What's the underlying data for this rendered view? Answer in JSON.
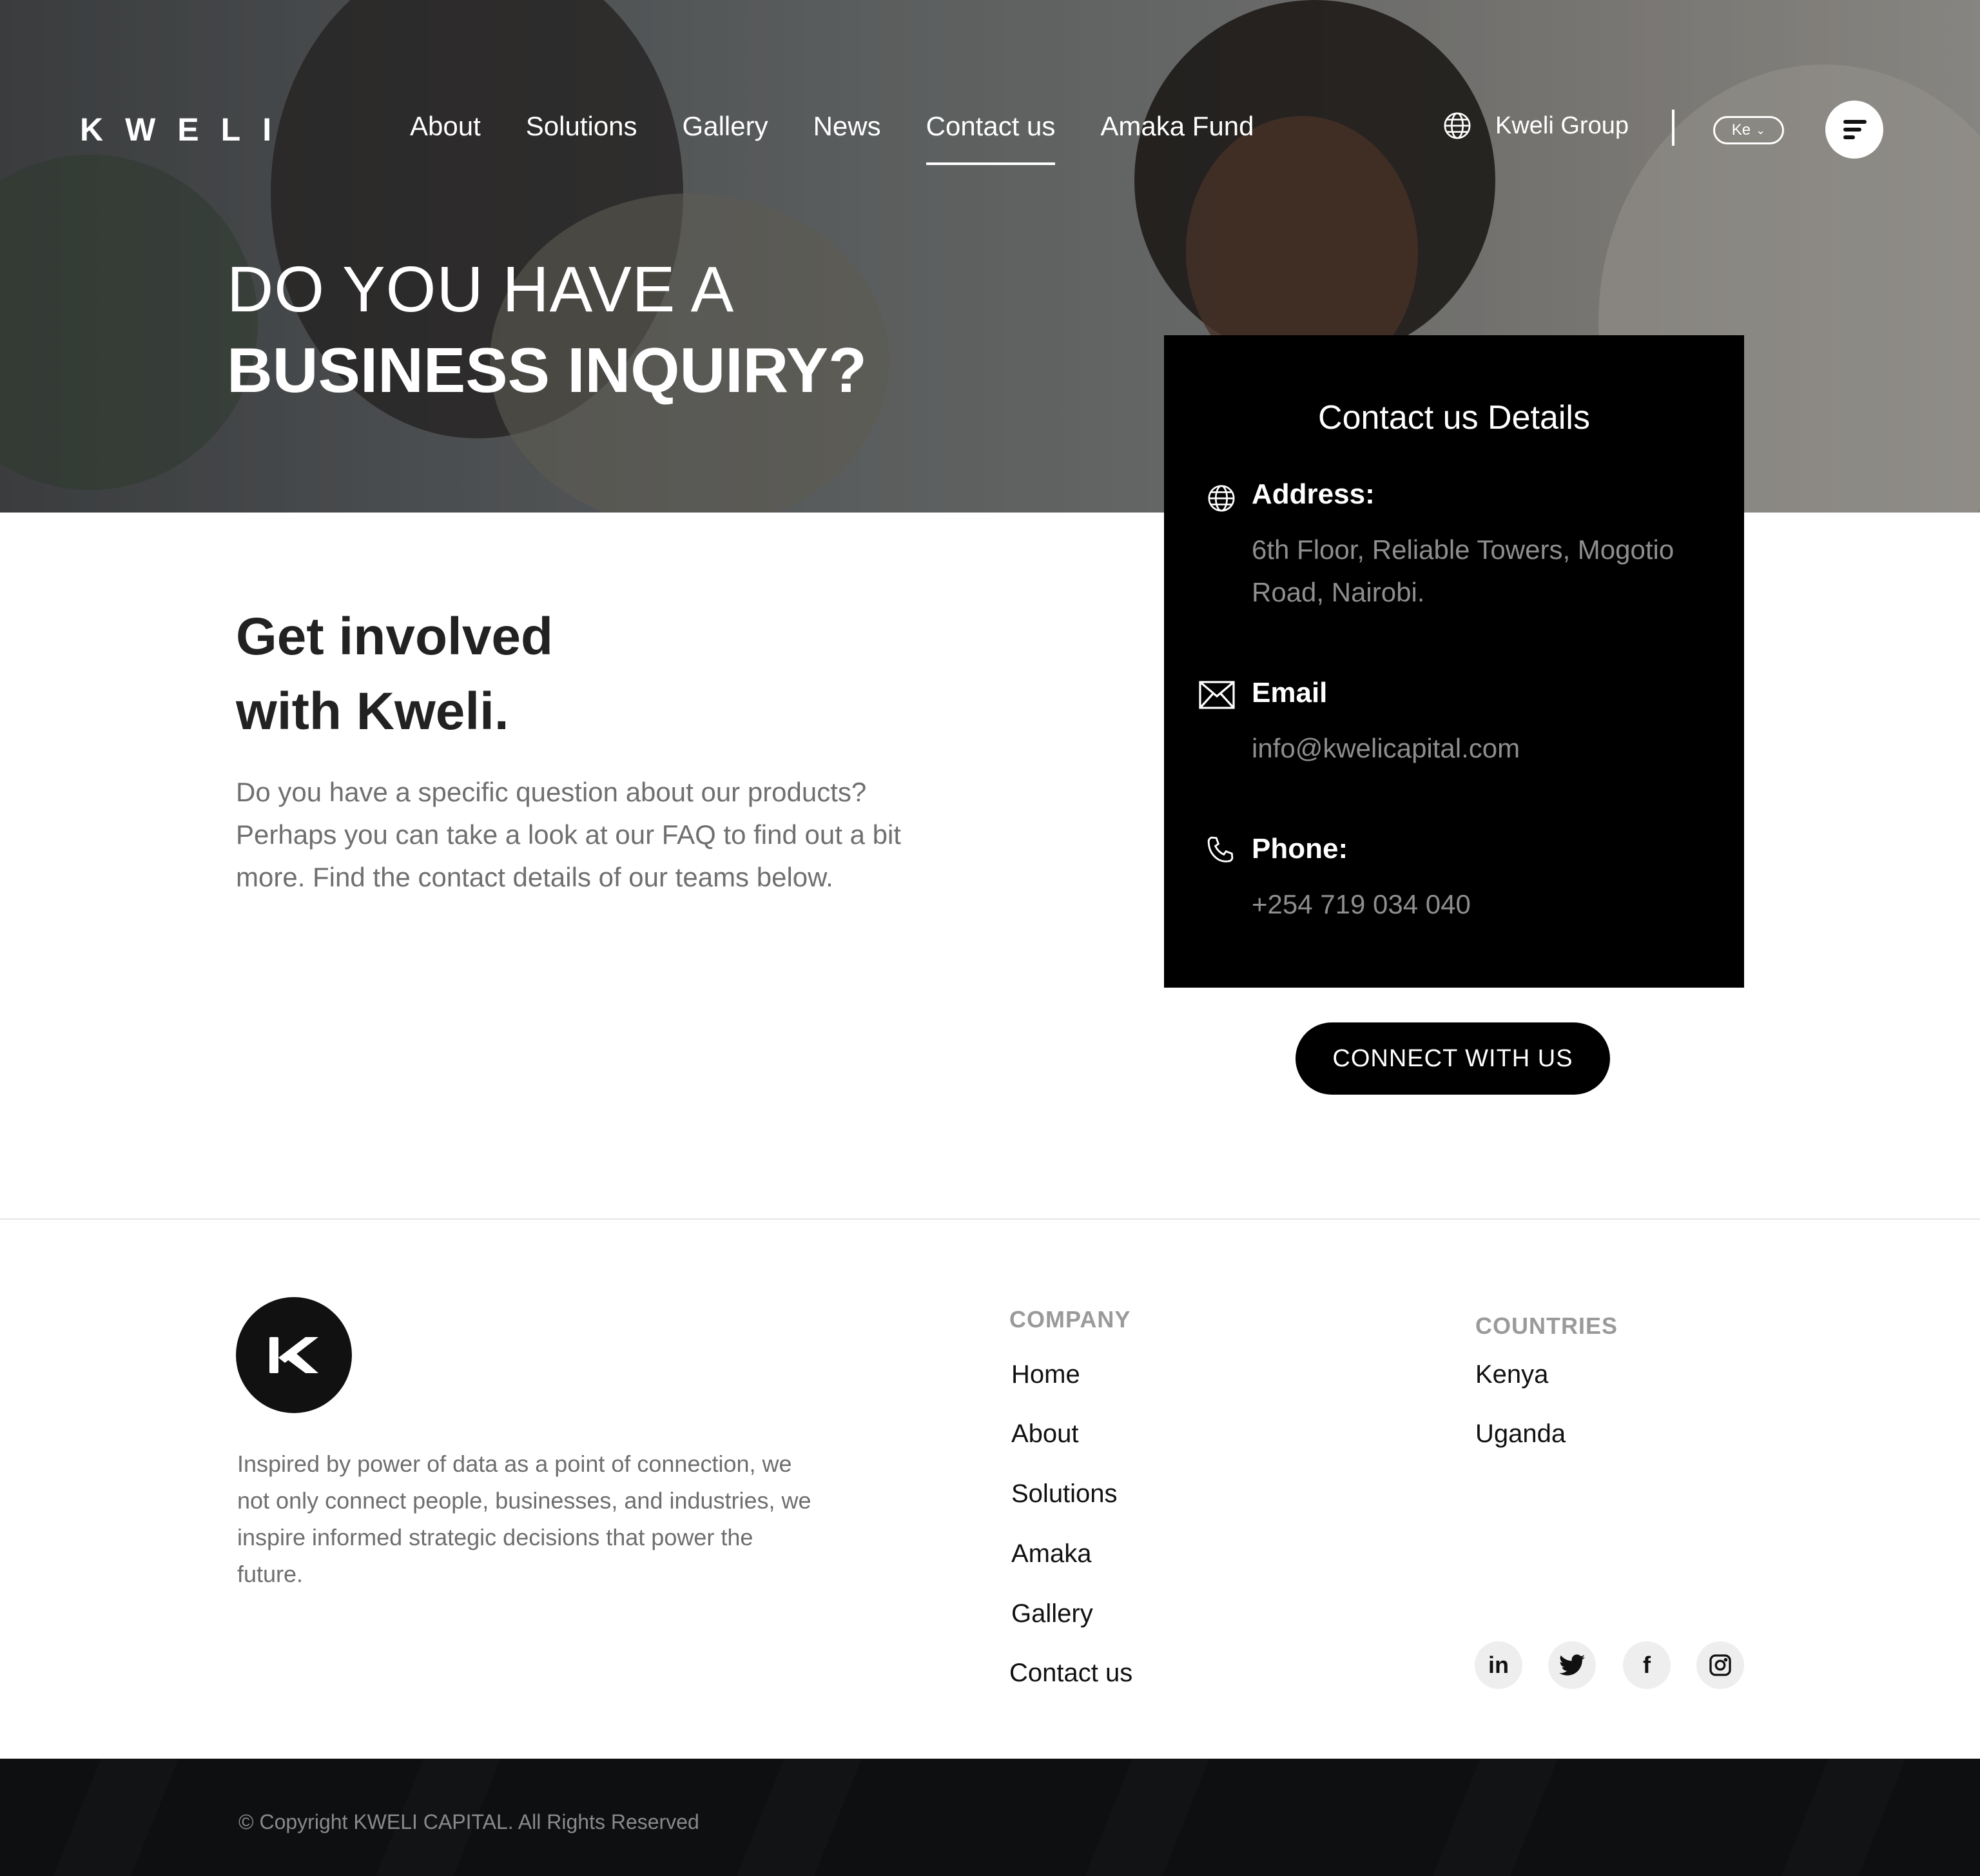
{
  "header": {
    "logo_text": "KWELI",
    "nav": [
      "About",
      "Solutions",
      "Gallery",
      "News",
      "Contact us",
      "Amaka Fund"
    ],
    "active_nav": "Contact us",
    "group_link": "Kweli Group",
    "language": "Ke",
    "menu_icon": "menu-icon"
  },
  "hero": {
    "line1": "DO YOU HAVE A",
    "line2": "BUSINESS INQUIRY?"
  },
  "contact_card": {
    "title": "Contact us Details",
    "address_label": "Address:",
    "address_value": "6th Floor, Reliable Towers, Mogotio Road, Nairobi.",
    "email_label": "Email",
    "email_value": "info@kwelicapital.com",
    "phone_label": "Phone:",
    "phone_value": "+254 719 034 040"
  },
  "cta": {
    "label": "CONNECT WITH US"
  },
  "intro": {
    "title_line1": "Get involved",
    "title_line2": "with Kweli.",
    "text": "Do you have a specific question about our products? Perhaps you can take a look at our FAQ to find out a bit more. Find the contact details of our teams below."
  },
  "footer": {
    "logo_letter": "K",
    "description": "Inspired by power of data as a point of connection, we not only connect people, businesses, and industries, we inspire informed strategic decisions that power the future.",
    "company_heading": "COMPANY",
    "company_links": [
      "Home",
      "About",
      "Solutions",
      "Amaka",
      "Gallery",
      "Contact us"
    ],
    "countries_heading": "COUNTRIES",
    "countries": [
      "Kenya",
      "Uganda"
    ],
    "social": {
      "linkedin": "in",
      "twitter": "twitter-icon",
      "facebook": "f",
      "instagram": "instagram-icon"
    },
    "copyright": "© Copyright KWELI CAPITAL. All Rights Reserved"
  },
  "colors": {
    "card_bg": "#000000",
    "muted_text": "#6f6f6f",
    "footer_bar": "#0e0f11"
  }
}
